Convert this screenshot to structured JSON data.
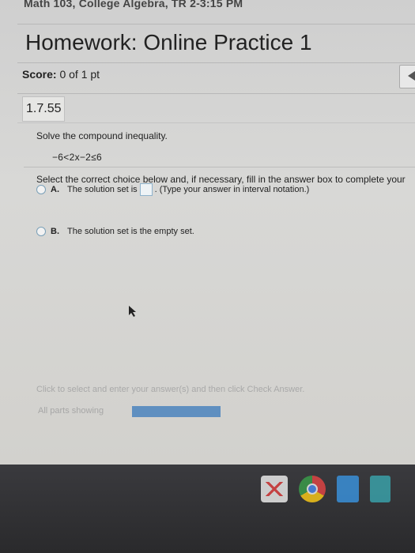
{
  "course": {
    "label": "Math 103, College Algebra, TR 2-3:15 PM"
  },
  "homework": {
    "title": "Homework: Online Practice 1"
  },
  "score": {
    "label": "Score:",
    "value": "0 of 1 pt"
  },
  "question": {
    "number": "1.7.55",
    "prompt": "Solve the compound inequality.",
    "inequality": "−6<2x−2≤6",
    "instruction": "Select the correct choice below and, if necessary, fill in the answer box to complete your",
    "choices": [
      {
        "letter": "A.",
        "text_before": "The solution set is",
        "text_after": ". (Type your answer in interval notation.)",
        "selected": false
      },
      {
        "letter": "B.",
        "text": "The solution set is the empty set.",
        "selected": false
      }
    ]
  },
  "footer": {
    "hint": "Click to select and enter your answer(s) and then click Check Answer.",
    "parts_label": "All parts showing",
    "progress_fraction": 1.0
  },
  "colors": {
    "accent": "#5f8fc0",
    "radio_border": "#7aa0b8"
  },
  "shelf": {
    "apps": [
      "gmail-icon",
      "chrome-icon",
      "docs-icon",
      "files-icon"
    ]
  }
}
